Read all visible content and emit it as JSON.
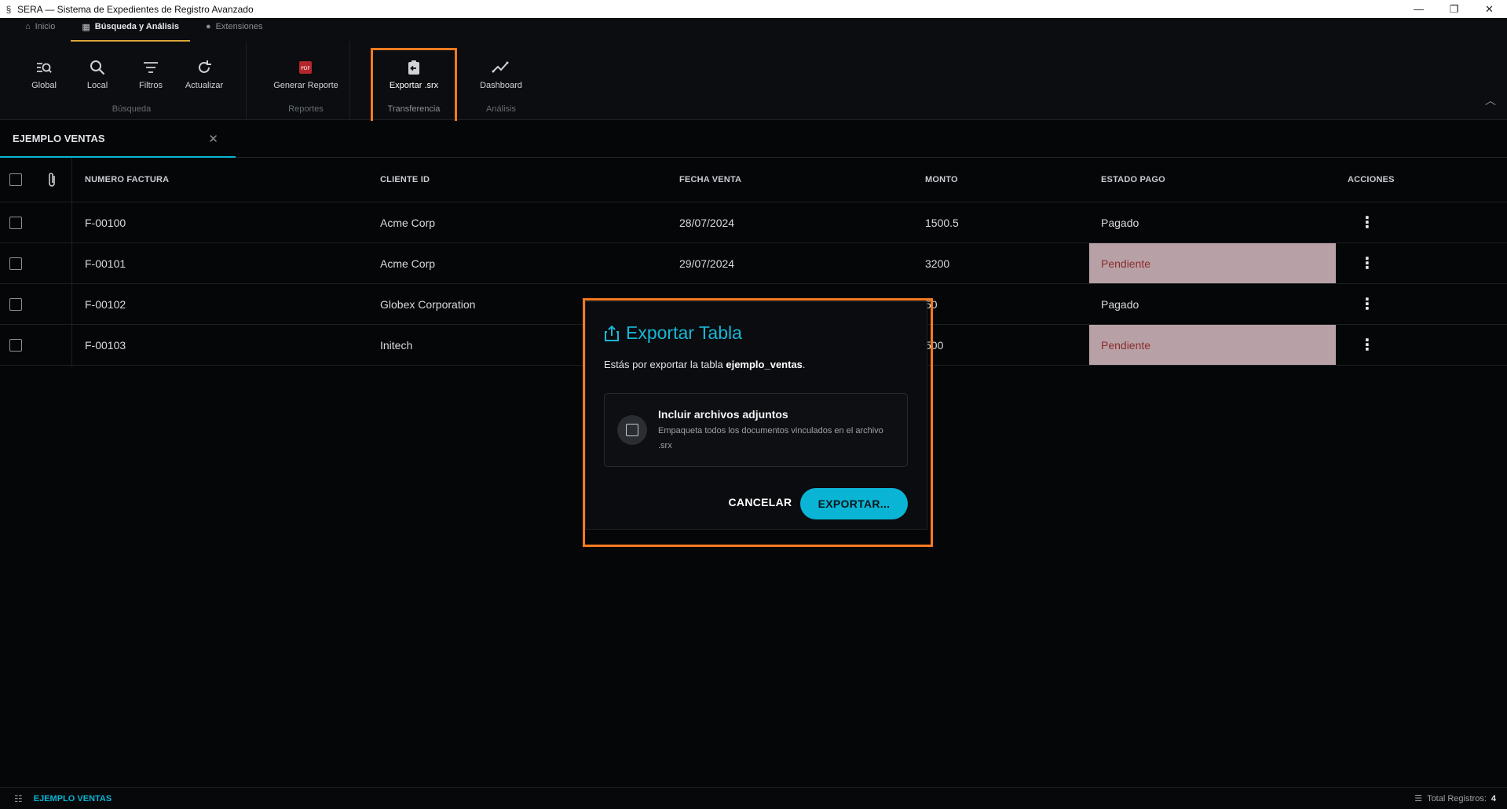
{
  "window": {
    "title": "SERA — Sistema de Expedientes de Registro Avanzado",
    "minimize": "—",
    "restore": "❐",
    "close": "✕"
  },
  "ribbon_tabs": [
    {
      "label": "Inicio",
      "icon": "home-icon"
    },
    {
      "label": "Búsqueda y Análisis",
      "icon": "table-icon",
      "active": true
    },
    {
      "label": "Extensiones",
      "icon": "puzzle-icon"
    }
  ],
  "ribbon": {
    "groups": {
      "busqueda": {
        "label": "Búsqueda",
        "buttons": {
          "global": "Global",
          "local": "Local",
          "filtros": "Filtros",
          "actualizar": "Actualizar"
        }
      },
      "reportes": {
        "label": "Reportes",
        "buttons": {
          "generar": "Generar Reporte"
        }
      },
      "transferencia": {
        "label": "Transferencia",
        "buttons": {
          "exportar": "Exportar .srx"
        }
      },
      "analisis": {
        "label": "Análisis",
        "buttons": {
          "dashboard": "Dashboard"
        }
      }
    }
  },
  "doc_tab": {
    "label": "EJEMPLO VENTAS",
    "close": "✕"
  },
  "table": {
    "headers": {
      "numero": "NUMERO FACTURA",
      "cliente": "CLIENTE ID",
      "fecha": "FECHA VENTA",
      "monto": "MONTO",
      "estado": "ESTADO PAGO",
      "acciones": "ACCIONES"
    },
    "rows": [
      {
        "numero": "F-00100",
        "cliente": "Acme Corp",
        "fecha": "28/07/2024",
        "monto": "1500.5",
        "estado": "Pagado"
      },
      {
        "numero": "F-00101",
        "cliente": "Acme Corp",
        "fecha": "29/07/2024",
        "monto": "3200",
        "estado": "Pendiente"
      },
      {
        "numero": "F-00102",
        "cliente": "Globex Corporation",
        "fecha": "",
        "monto": "50",
        "estado": "Pagado"
      },
      {
        "numero": "F-00103",
        "cliente": "Initech",
        "fecha": "",
        "monto": "500",
        "estado": "Pendiente"
      }
    ]
  },
  "dialog": {
    "title": "Exportar Tabla",
    "message_prefix": "Estás por exportar la tabla ",
    "message_table": "ejemplo_ventas",
    "message_suffix": ".",
    "option_title": "Incluir archivos adjuntos",
    "option_desc": "Empaqueta todos los documentos vinculados en el archivo .srx",
    "cancel": "CANCELAR",
    "export": "EXPORTAR..."
  },
  "status_bar": {
    "table_name": "EJEMPLO VENTAS",
    "total_label": "Total Registros:",
    "total_value": "4"
  },
  "colors": {
    "accent": "#0ab4d4",
    "highlight": "#f47b20",
    "pending_bg": "#b8a1a6",
    "pending_text": "#8a2c2c"
  }
}
